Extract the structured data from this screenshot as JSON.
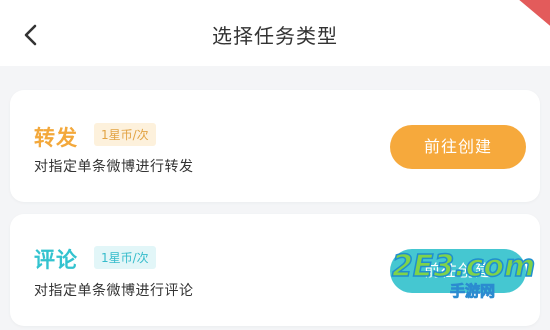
{
  "header": {
    "title": "选择任务类型",
    "back_icon": "chevron-left-icon"
  },
  "tasks": [
    {
      "name": "转发",
      "reward": "1星币/次",
      "description": "对指定单条微博进行转发",
      "action_label": "前往创建",
      "accent_color": "#f3a83b"
    },
    {
      "name": "评论",
      "reward": "1星币/次",
      "description": "对指定单条微博进行评论",
      "action_label": "前往创建",
      "accent_color": "#33c3cf"
    }
  ],
  "watermark": {
    "logo": "2E3.com",
    "caption": "手游网"
  },
  "colors": {
    "background": "#f4f5f7",
    "card": "#ffffff",
    "orange_button": "#f6a93c",
    "teal_button": "#45c7d1"
  }
}
